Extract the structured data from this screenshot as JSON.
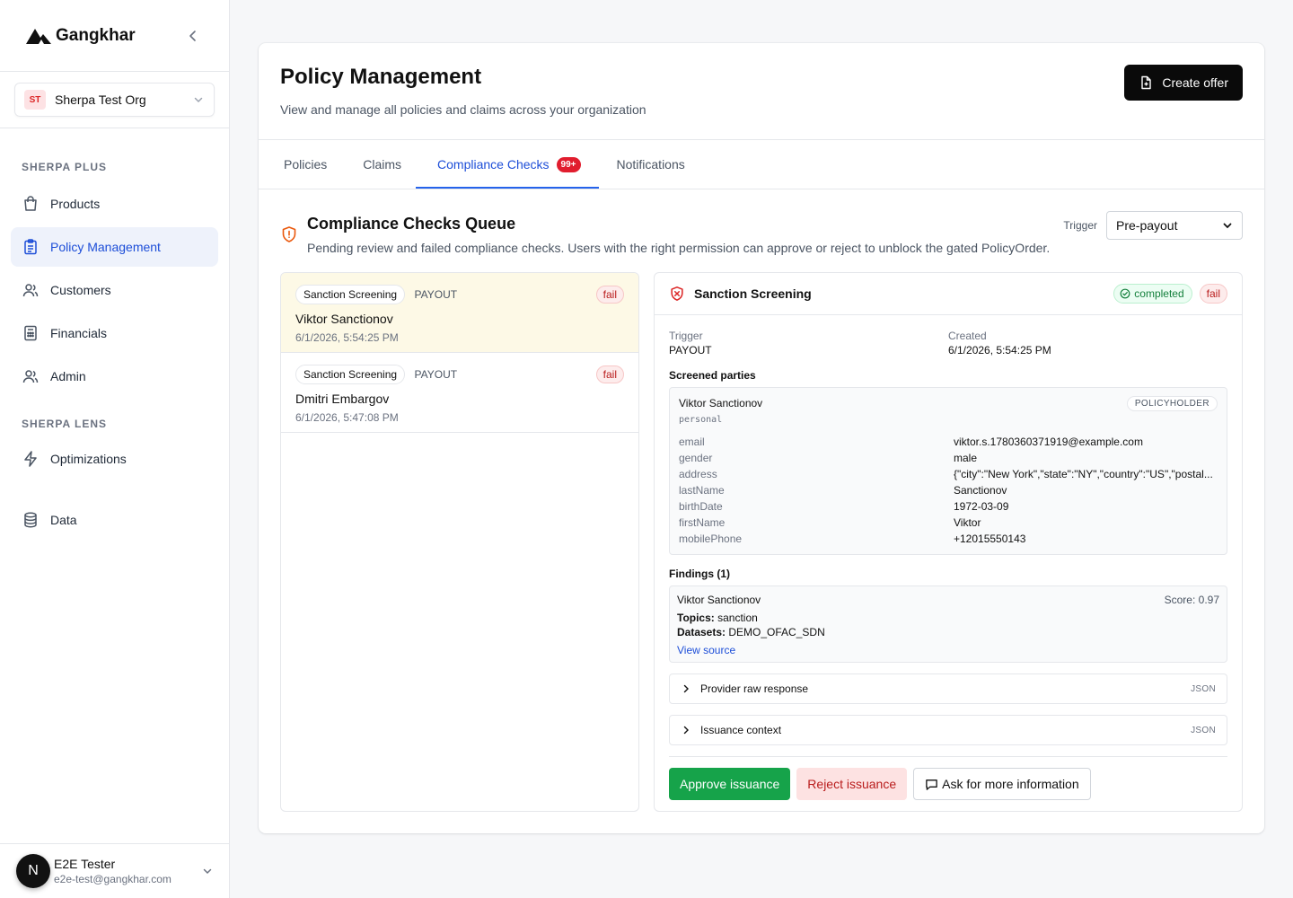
{
  "brand": {
    "name": "Gangkhar"
  },
  "org": {
    "initials": "ST",
    "name": "Sherpa Test Org"
  },
  "sidebar": {
    "section_plus": "SHERPA PLUS",
    "section_lens": "SHERPA LENS",
    "items": [
      {
        "label": "Products",
        "icon": "bag-icon"
      },
      {
        "label": "Policy Management",
        "icon": "clipboard-icon",
        "active": true
      },
      {
        "label": "Customers",
        "icon": "users-icon"
      },
      {
        "label": "Financials",
        "icon": "calculator-icon"
      },
      {
        "label": "Admin",
        "icon": "users-icon"
      }
    ],
    "lens_items": [
      {
        "label": "Optimizations",
        "icon": "bolt-icon"
      },
      {
        "label": "Data",
        "icon": "database-icon"
      }
    ]
  },
  "user": {
    "initial": "N",
    "name": "E2E Tester",
    "email": "e2e-test@gangkhar.com"
  },
  "page": {
    "title": "Policy Management",
    "subtitle": "View and manage all policies and claims across your organization",
    "create_label": "Create offer"
  },
  "tabs": [
    {
      "label": "Policies"
    },
    {
      "label": "Claims"
    },
    {
      "label": "Compliance Checks",
      "count": "99+",
      "active": true
    },
    {
      "label": "Notifications"
    }
  ],
  "queue": {
    "title": "Compliance Checks Queue",
    "subtitle": "Pending review and failed compliance checks. Users with the right permission can approve or reject to unblock the gated PolicyOrder.",
    "trigger_label": "Trigger",
    "trigger_value": "Pre-payout"
  },
  "checks": [
    {
      "type": "Sanction Screening",
      "trigger": "PAYOUT",
      "status": "fail",
      "name": "Viktor Sanctionov",
      "date": "6/1/2026, 5:54:25 PM"
    },
    {
      "type": "Sanction Screening",
      "trigger": "PAYOUT",
      "status": "fail",
      "name": "Dmitri Embargov",
      "date": "6/1/2026, 5:47:08 PM"
    }
  ],
  "detail": {
    "title": "Sanction Screening",
    "completed": "completed",
    "status": "fail",
    "trigger_label": "Trigger",
    "trigger_value": "PAYOUT",
    "created_label": "Created",
    "created_value": "6/1/2026, 5:54:25 PM",
    "parties_label": "Screened parties",
    "party": {
      "name": "Viktor Sanctionov",
      "type": "personal",
      "role": "POLICYHOLDER",
      "fields": [
        {
          "k": "email",
          "v": "viktor.s.1780360371919@example.com"
        },
        {
          "k": "gender",
          "v": "male"
        },
        {
          "k": "address",
          "v": "{\"city\":\"New York\",\"state\":\"NY\",\"country\":\"US\",\"postal..."
        },
        {
          "k": "lastName",
          "v": "Sanctionov"
        },
        {
          "k": "birthDate",
          "v": "1972-03-09"
        },
        {
          "k": "firstName",
          "v": "Viktor"
        },
        {
          "k": "mobilePhone",
          "v": "+12015550143"
        }
      ]
    },
    "findings_label": "Findings (1)",
    "finding": {
      "name": "Viktor Sanctionov",
      "score": "Score: 0.97",
      "topics_label": "Topics:",
      "topics": "sanction",
      "datasets_label": "Datasets:",
      "datasets": "DEMO_OFAC_SDN",
      "view_source": "View source"
    },
    "raw_label": "Provider raw response",
    "raw_tag": "JSON",
    "context_label": "Issuance context",
    "context_tag": "JSON",
    "approve": "Approve issuance",
    "reject": "Reject issuance",
    "ask": "Ask for more information"
  },
  "colors": {
    "accent": "#1d4ed8",
    "approve": "#16a34a",
    "fail": "#b91c1c",
    "badge": "#e11d2e"
  }
}
